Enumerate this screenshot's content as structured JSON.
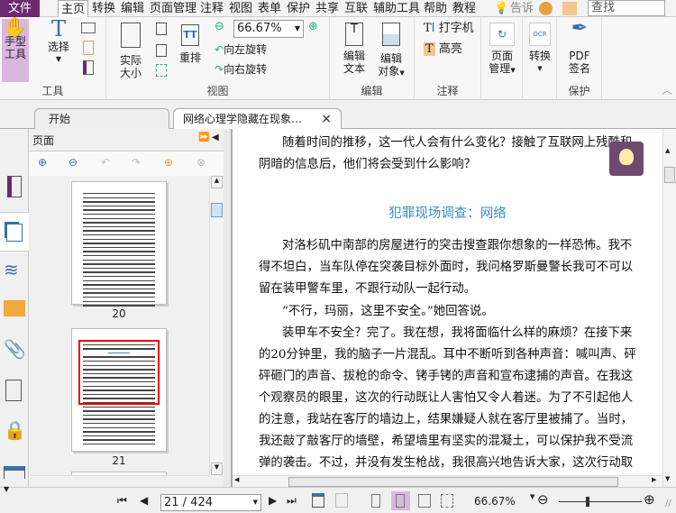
{
  "menu": {
    "file": "文件",
    "tabs": [
      "主页",
      "转换",
      "编辑",
      "页面管理",
      "注释",
      "视图",
      "表单",
      "保护",
      "共享",
      "互联",
      "辅助工具",
      "帮助",
      "教程"
    ],
    "tell": "告诉",
    "search_placeholder": "查找"
  },
  "ribbon": {
    "tools": {
      "hand": "手型\n工具",
      "hand_l1": "手型",
      "hand_l2": "工具",
      "select_l1": "选择",
      "label": "工具"
    },
    "view": {
      "actual_l1": "实际",
      "actual_l2": "大小",
      "reflow": "重排",
      "zoom": "66.67%",
      "rotate_left": "向左旋转",
      "rotate_right": "向右旋转",
      "label": "视图"
    },
    "edit": {
      "text_l1": "编辑",
      "text_l2": "文本",
      "obj_l1": "编辑",
      "obj_l2": "对象",
      "label": "编辑"
    },
    "comment": {
      "typewriter": "打字机",
      "highlight": "高亮",
      "label": "注释"
    },
    "page": {
      "l1": "页面",
      "l2": "管理"
    },
    "convert": {
      "l1": "转换"
    },
    "protect": {
      "l1": "PDF",
      "l2": "签名",
      "label": "保护"
    }
  },
  "tabs": [
    {
      "label": "开始"
    },
    {
      "label": "网络心理学隐藏在现象…",
      "close": "×"
    }
  ],
  "panel": {
    "title": "页面",
    "thumbnails": [
      {
        "page": "20"
      },
      {
        "page": "21"
      }
    ]
  },
  "document": {
    "lines": [
      "随着时间的推移，这一代人会有什么变化？接触了互联网上残酷和",
      "阴暗的信息后，他们将会受到什么影响？",
      "对洛杉矶中南部的房屋进行的突击搜查跟你想象的一样恐怖。我不",
      "得不坦白，当车队停在突袭目标外面时，我问格罗斯曼警长我可不可以",
      "留在装甲警车里，不跟行动队一起行动。",
      "“不行，玛丽，这里不安全。”她回答说。",
      "装甲车不安全？完了。我在想，我将面临什么样的麻烦？在接下来",
      "的20分钟里，我的脑子一片混乱。耳中不断听到各种声音：喊叫声、砰",
      "砰砸门的声音、拔枪的命令、铐手铐的声音和宣布逮捕的声音。在我这",
      "个观察员的眼里，这次的行动既让人害怕又令人着迷。为了不引起他人",
      "的注意，我站在客厅的墙边上，结果嫌疑人就在客厅里被捕了。当时，",
      "我还敲了敲客厅的墙壁，希望墙里有坚实的混凝土，可以保护我不受流",
      "弹的袭击。不过，并没有发生枪战，我很高兴地告诉大家，这次行动取"
    ],
    "heading": "犯罪现场调查：网络"
  },
  "status": {
    "page": "21 / 424",
    "zoom": "66.67%",
    "zoom_slider": 0.35
  },
  "colors": {
    "brand": "#6b2a6e",
    "heading": "#3a8dc8",
    "highlight": "#d9b8e0"
  }
}
